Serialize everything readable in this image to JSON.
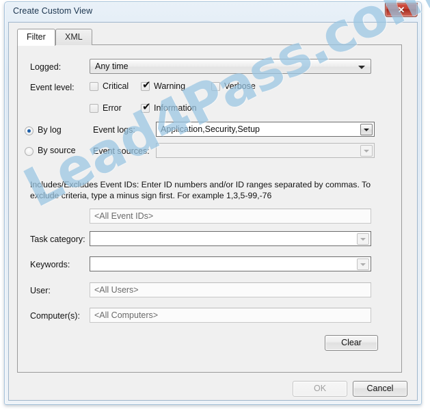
{
  "window": {
    "title": "Create Custom View",
    "close_label": "✕"
  },
  "tabs": [
    {
      "label": "Filter",
      "active": true
    },
    {
      "label": "XML",
      "active": false
    }
  ],
  "form": {
    "logged": {
      "label": "Logged:",
      "value": "Any time"
    },
    "event_level": {
      "label": "Event level:",
      "options": [
        {
          "label": "Critical",
          "checked": false
        },
        {
          "label": "Warning",
          "checked": true
        },
        {
          "label": "Verbose",
          "checked": false
        },
        {
          "label": "Error",
          "checked": false
        },
        {
          "label": "Information",
          "checked": true
        }
      ],
      "check_glyph": "✔"
    },
    "source_mode": {
      "by_log_label": "By log",
      "by_source_label": "By source",
      "selected": "by_log"
    },
    "event_logs": {
      "label": "Event logs:",
      "value": "Application,Security,Setup",
      "enabled": true
    },
    "event_sources": {
      "label": "Event sources:",
      "value": "",
      "enabled": false
    },
    "event_ids": {
      "description": "Includes/Excludes Event IDs: Enter ID numbers and/or ID ranges separated by commas. To exclude criteria, type a minus sign first. For example 1,3,5-99,-76",
      "placeholder": "<All Event IDs>"
    },
    "task_category": {
      "label": "Task category:",
      "value": ""
    },
    "keywords": {
      "label": "Keywords:",
      "value": ""
    },
    "user": {
      "label": "User:",
      "placeholder": "<All Users>"
    },
    "computers": {
      "label": "Computer(s):",
      "placeholder": "<All Computers>"
    },
    "clear_button": "Clear"
  },
  "footer": {
    "ok_label": "OK",
    "ok_enabled": false,
    "cancel_label": "Cancel",
    "cancel_enabled": true
  },
  "watermark": {
    "text": "Lead4Pass.com"
  },
  "colors": {
    "accent": "#1d5fa8",
    "close_button": "#c33f30",
    "watermark": "#9ac6e3",
    "dialog_bg": "#f0f0f0"
  }
}
